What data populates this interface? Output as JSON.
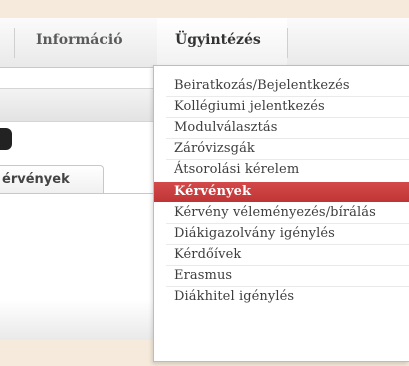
{
  "nav": {
    "items": [
      {
        "label": "Információ"
      },
      {
        "label": "Ügyintézés"
      }
    ]
  },
  "panel": {
    "tab_label": "érvények"
  },
  "dropdown": {
    "items": [
      {
        "label": "Beiratkozás/Bejelentkezés"
      },
      {
        "label": "Kollégiumi jelentkezés"
      },
      {
        "label": "Modulválasztás"
      },
      {
        "label": "Záróvizsgák"
      },
      {
        "label": "Átsorolási kérelem"
      },
      {
        "label": "Kérvények",
        "active": true
      },
      {
        "label": "Kérvény véleményezés/bírálás"
      },
      {
        "label": "Diákigazolvány igénylés"
      },
      {
        "label": "Kérdőívek"
      },
      {
        "label": "Erasmus"
      },
      {
        "label": "Diákhitel igénylés"
      }
    ]
  },
  "colors": {
    "active_item": "#c93d3d",
    "background": "#f5eadb"
  }
}
